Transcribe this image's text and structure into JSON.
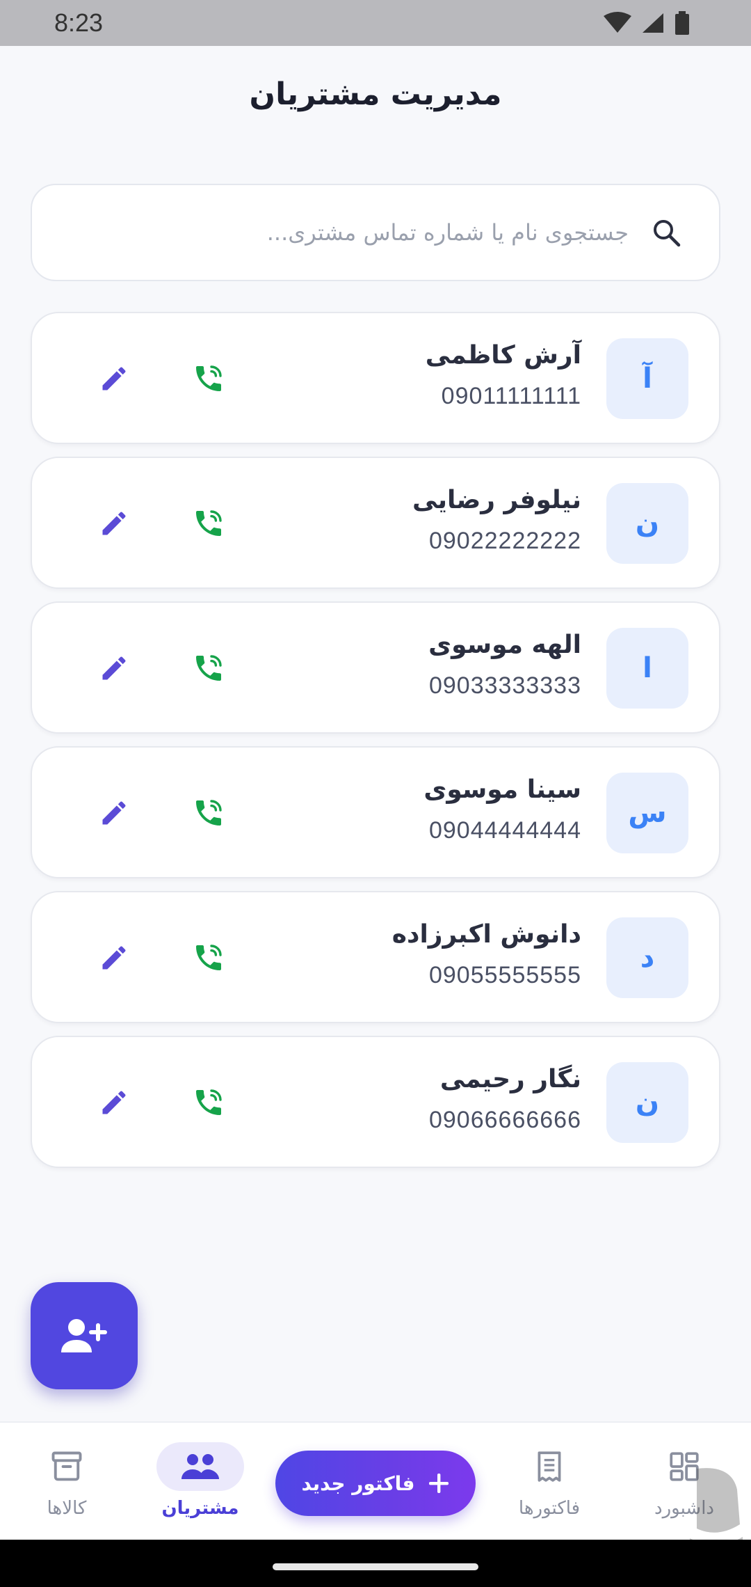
{
  "status_bar": {
    "time": "8:23"
  },
  "header": {
    "title": "مدیریت مشتریان"
  },
  "search": {
    "placeholder": "جستجوی نام یا شماره تماس مشتری...",
    "value": ""
  },
  "customers": [
    {
      "initial": "آ",
      "name": "آرش کاظمی",
      "phone": "09011111111"
    },
    {
      "initial": "ن",
      "name": "نیلوفر رضایی",
      "phone": "09022222222"
    },
    {
      "initial": "ا",
      "name": "الهه موسوی",
      "phone": "09033333333"
    },
    {
      "initial": "س",
      "name": "سینا موسوی",
      "phone": "09044444444"
    },
    {
      "initial": "د",
      "name": "دانوش اکبرزاده",
      "phone": "09055555555"
    },
    {
      "initial": "ن",
      "name": "نگار رحیمی",
      "phone": "09066666666"
    }
  ],
  "fab": {
    "icon": "add-user-icon"
  },
  "bottom_nav": {
    "products": "کالاها",
    "customers": "مشتریان",
    "new_invoice": "فاکتور جدید",
    "invoices": "فاکتورها",
    "dashboard": "داشبورد",
    "active": "customers"
  },
  "colors": {
    "accent": "#4f46e5",
    "call_green": "#16a34a",
    "edit_purple": "#5b4bd6",
    "avatar_bg": "#e8effd",
    "avatar_text": "#3b82f6"
  }
}
